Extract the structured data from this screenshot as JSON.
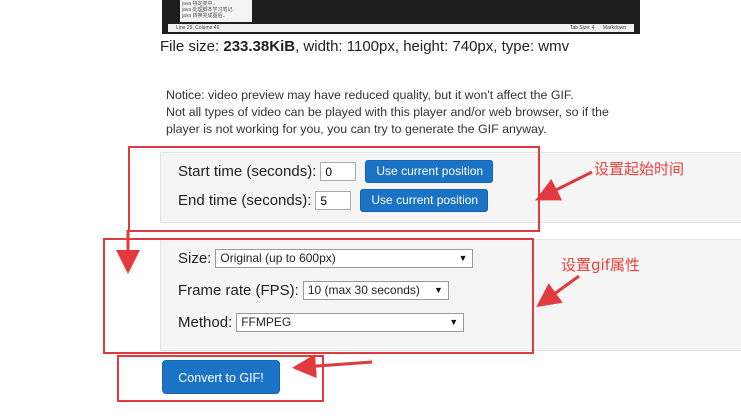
{
  "video_preview": {
    "tree_lines": [
      "java 特定类中..",
      "java 处理脚本学习笔记",
      "java 转换完成图后.."
    ],
    "status_left": "Line 29, Column 46",
    "status_right_tab": "Tab Size: 4",
    "status_right_lang": "Markdown"
  },
  "file_info": {
    "size_label": "File size: ",
    "size_value": "233.38KiB",
    "rest": ", width: 1100px, height: 740px, type: wmv"
  },
  "notice": {
    "line1": "Notice: video preview may have reduced quality, but it won't affect the GIF.",
    "line2": "Not all types of video can be played with this player and/or web browser, so if the",
    "line3": "player is not working for you, you can try to generate the GIF anyway."
  },
  "time_settings": {
    "start_label": "Start time (seconds):",
    "start_value": "0",
    "end_label": "End time (seconds):",
    "end_value": "5",
    "use_current_label": "Use current position"
  },
  "gif_settings": {
    "size_label": "Size:",
    "size_value": "Original (up to 600px)",
    "fps_label": "Frame rate (FPS):",
    "fps_value": "10 (max 30 seconds)",
    "method_label": "Method:",
    "method_value": "FFMPEG"
  },
  "convert_label": "Convert to GIF!",
  "annotations": {
    "time_note": "设置起始时间",
    "gif_note": "设置gif属性"
  },
  "colors": {
    "accent": "#1a73c4",
    "annotation_red": "#e0393e"
  },
  "icons": {
    "dropdown": "caret-down-icon",
    "arrow": "red-arrow-icon"
  }
}
